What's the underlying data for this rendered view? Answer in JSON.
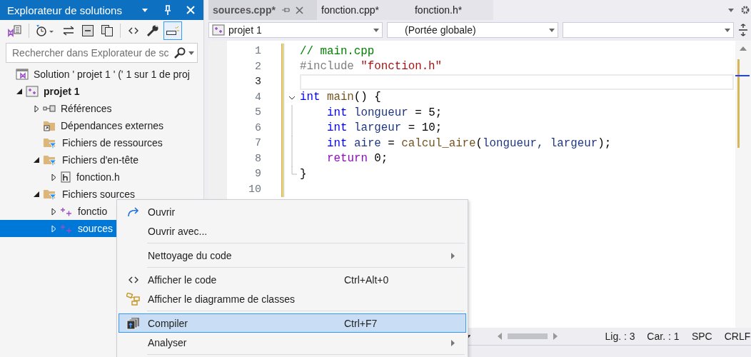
{
  "explorer": {
    "title": "Explorateur de solutions",
    "toolbar": [
      {
        "pressed": false
      },
      {
        "pressed": false
      },
      {
        "pressed": false
      },
      {
        "pressed": false
      },
      {
        "pressed": false
      },
      {
        "pressed": false
      },
      {
        "pressed": false
      },
      {
        "pressed": true
      }
    ],
    "search": {
      "placeholder": "Rechercher dans Explorateur de sc"
    },
    "tree": [
      {
        "label": "Solution ' projet 1 ' (' 1 sur 1 de proj",
        "kind": "solution",
        "selected": false,
        "children": [
          {
            "label": "projet 1",
            "kind": "project",
            "expanded": true,
            "selected": false,
            "children": [
              {
                "label": "Références",
                "kind": "references",
                "expanded": false,
                "selected": false
              },
              {
                "label": "Dépendances externes",
                "kind": "external",
                "selected": false
              },
              {
                "label": "Fichiers de ressources",
                "kind": "filter",
                "selected": false
              },
              {
                "label": "Fichiers d'en-tête",
                "kind": "filter",
                "expanded": true,
                "selected": false,
                "children": [
                  {
                    "label": "fonction.h",
                    "kind": "header",
                    "expanded": false,
                    "selected": false
                  }
                ]
              },
              {
                "label": "Fichiers sources",
                "kind": "filter",
                "expanded": true,
                "selected": false,
                "children": [
                  {
                    "label": "fonctio",
                    "kind": "source",
                    "expanded": false,
                    "selected": false
                  },
                  {
                    "label": "sources",
                    "kind": "source",
                    "expanded": false,
                    "selected": true
                  }
                ]
              }
            ]
          }
        ]
      }
    ]
  },
  "editor": {
    "tabs": [
      {
        "label": "sources.cpp*",
        "selected": true
      },
      {
        "label": "fonction.cpp*",
        "selected": false
      },
      {
        "label": "fonction.h*",
        "selected": false
      }
    ],
    "nav": {
      "project": "projet 1",
      "scope": "(Portée globale)"
    },
    "lines": [
      {
        "number": "1",
        "current": false,
        "tokens": [
          {
            "t": "// main.cpp",
            "color": "#008000"
          }
        ]
      },
      {
        "number": "2",
        "current": false,
        "tokens": [
          {
            "t": "#include ",
            "color": "#808080"
          },
          {
            "t": "\"fonction.h\"",
            "color": "#a31515"
          }
        ]
      },
      {
        "number": "3",
        "current": true
      },
      {
        "number": "4",
        "current": false,
        "expanded": true,
        "tokens": [
          {
            "t": "int ",
            "color": "#0000ff"
          },
          {
            "t": "main",
            "color": "#74531f"
          },
          {
            "t": "() {",
            "color": "#000000"
          }
        ]
      },
      {
        "number": "5",
        "current": false,
        "indented": true,
        "tokens": [
          {
            "t": "int ",
            "color": "#0000ff"
          },
          {
            "t": "longueur",
            "color": "#1f377f"
          },
          {
            "t": " = 5;",
            "color": "#000000"
          }
        ]
      },
      {
        "number": "6",
        "current": false,
        "indented": true,
        "tokens": [
          {
            "t": "int ",
            "color": "#0000ff"
          },
          {
            "t": "largeur",
            "color": "#1f377f"
          },
          {
            "t": " = 10;",
            "color": "#000000"
          }
        ]
      },
      {
        "number": "7",
        "current": false,
        "indented": true,
        "tokens": [
          {
            "t": "int ",
            "color": "#0000ff"
          },
          {
            "t": "aire",
            "color": "#1f377f"
          },
          {
            "t": " = ",
            "color": "#000000"
          },
          {
            "t": "calcul_aire",
            "color": "#74531f"
          },
          {
            "t": "(",
            "color": "#000000"
          },
          {
            "t": "longueur, ",
            "color": "#1f377f"
          },
          {
            "t": "largeur",
            "color": "#1f377f"
          },
          {
            "t": ");",
            "color": "#000000"
          }
        ]
      },
      {
        "number": "8",
        "current": false,
        "indented": true,
        "tokens": [
          {
            "t": "return",
            "color": "#8f08c4"
          },
          {
            "t": " 0;",
            "color": "#000000"
          }
        ]
      },
      {
        "number": "9",
        "current": false,
        "block_end": true,
        "tokens": [
          {
            "t": "}",
            "color": "#000000"
          }
        ]
      },
      {
        "number": "10",
        "current": false
      }
    ],
    "status": {
      "line": "Lig. : 3",
      "column": "Car. : 1",
      "indent": "SPC",
      "eol": "CRLF"
    }
  },
  "context_menu": [
    {
      "kind": "item",
      "label": "Ouvrir",
      "selected": false
    },
    {
      "kind": "item",
      "label": "Ouvrir avec...",
      "selected": false
    },
    {
      "kind": "separator"
    },
    {
      "kind": "item",
      "label": "Nettoyage du code",
      "submenu": true,
      "selected": false
    },
    {
      "kind": "separator"
    },
    {
      "kind": "item",
      "label": "Afficher le code",
      "shortcut": "Ctrl+Alt+0",
      "selected": false
    },
    {
      "kind": "item",
      "label": "Afficher le diagramme de classes",
      "selected": false
    },
    {
      "kind": "separator"
    },
    {
      "kind": "item",
      "label": "Compiler",
      "shortcut": "Ctrl+F7",
      "selected": true
    },
    {
      "kind": "item",
      "label": "Analyser",
      "submenu": true,
      "selected": false
    },
    {
      "kind": "separator"
    }
  ]
}
